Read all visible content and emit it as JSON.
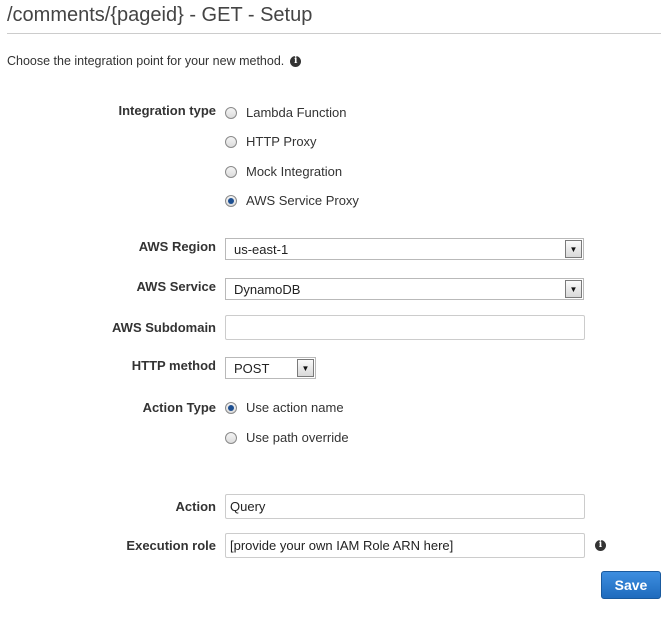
{
  "page": {
    "title": "/comments/{pageid} - GET - Setup",
    "intro": "Choose the integration point for your new method."
  },
  "integration_type": {
    "label": "Integration type",
    "options": [
      {
        "label": "Lambda Function",
        "selected": false
      },
      {
        "label": "HTTP Proxy",
        "selected": false
      },
      {
        "label": "Mock Integration",
        "selected": false
      },
      {
        "label": "AWS Service Proxy",
        "selected": true
      }
    ]
  },
  "aws_region": {
    "label": "AWS Region",
    "value": "us-east-1"
  },
  "aws_service": {
    "label": "AWS Service",
    "value": "DynamoDB"
  },
  "aws_subdomain": {
    "label": "AWS Subdomain",
    "value": ""
  },
  "http_method": {
    "label": "HTTP method",
    "value": "POST"
  },
  "action_type": {
    "label": "Action Type",
    "options": [
      {
        "label": "Use action name",
        "selected": true
      },
      {
        "label": "Use path override",
        "selected": false
      }
    ]
  },
  "action": {
    "label": "Action",
    "value": "Query"
  },
  "execution_role": {
    "label": "Execution role",
    "value": "[provide your own IAM Role ARN here]"
  },
  "buttons": {
    "save": "Save"
  },
  "colors": {
    "accent": "#2a78cf",
    "radio_checked": "#1d4f91"
  },
  "icons": {
    "info": "info-icon",
    "dropdown": "chevron-down-icon"
  }
}
